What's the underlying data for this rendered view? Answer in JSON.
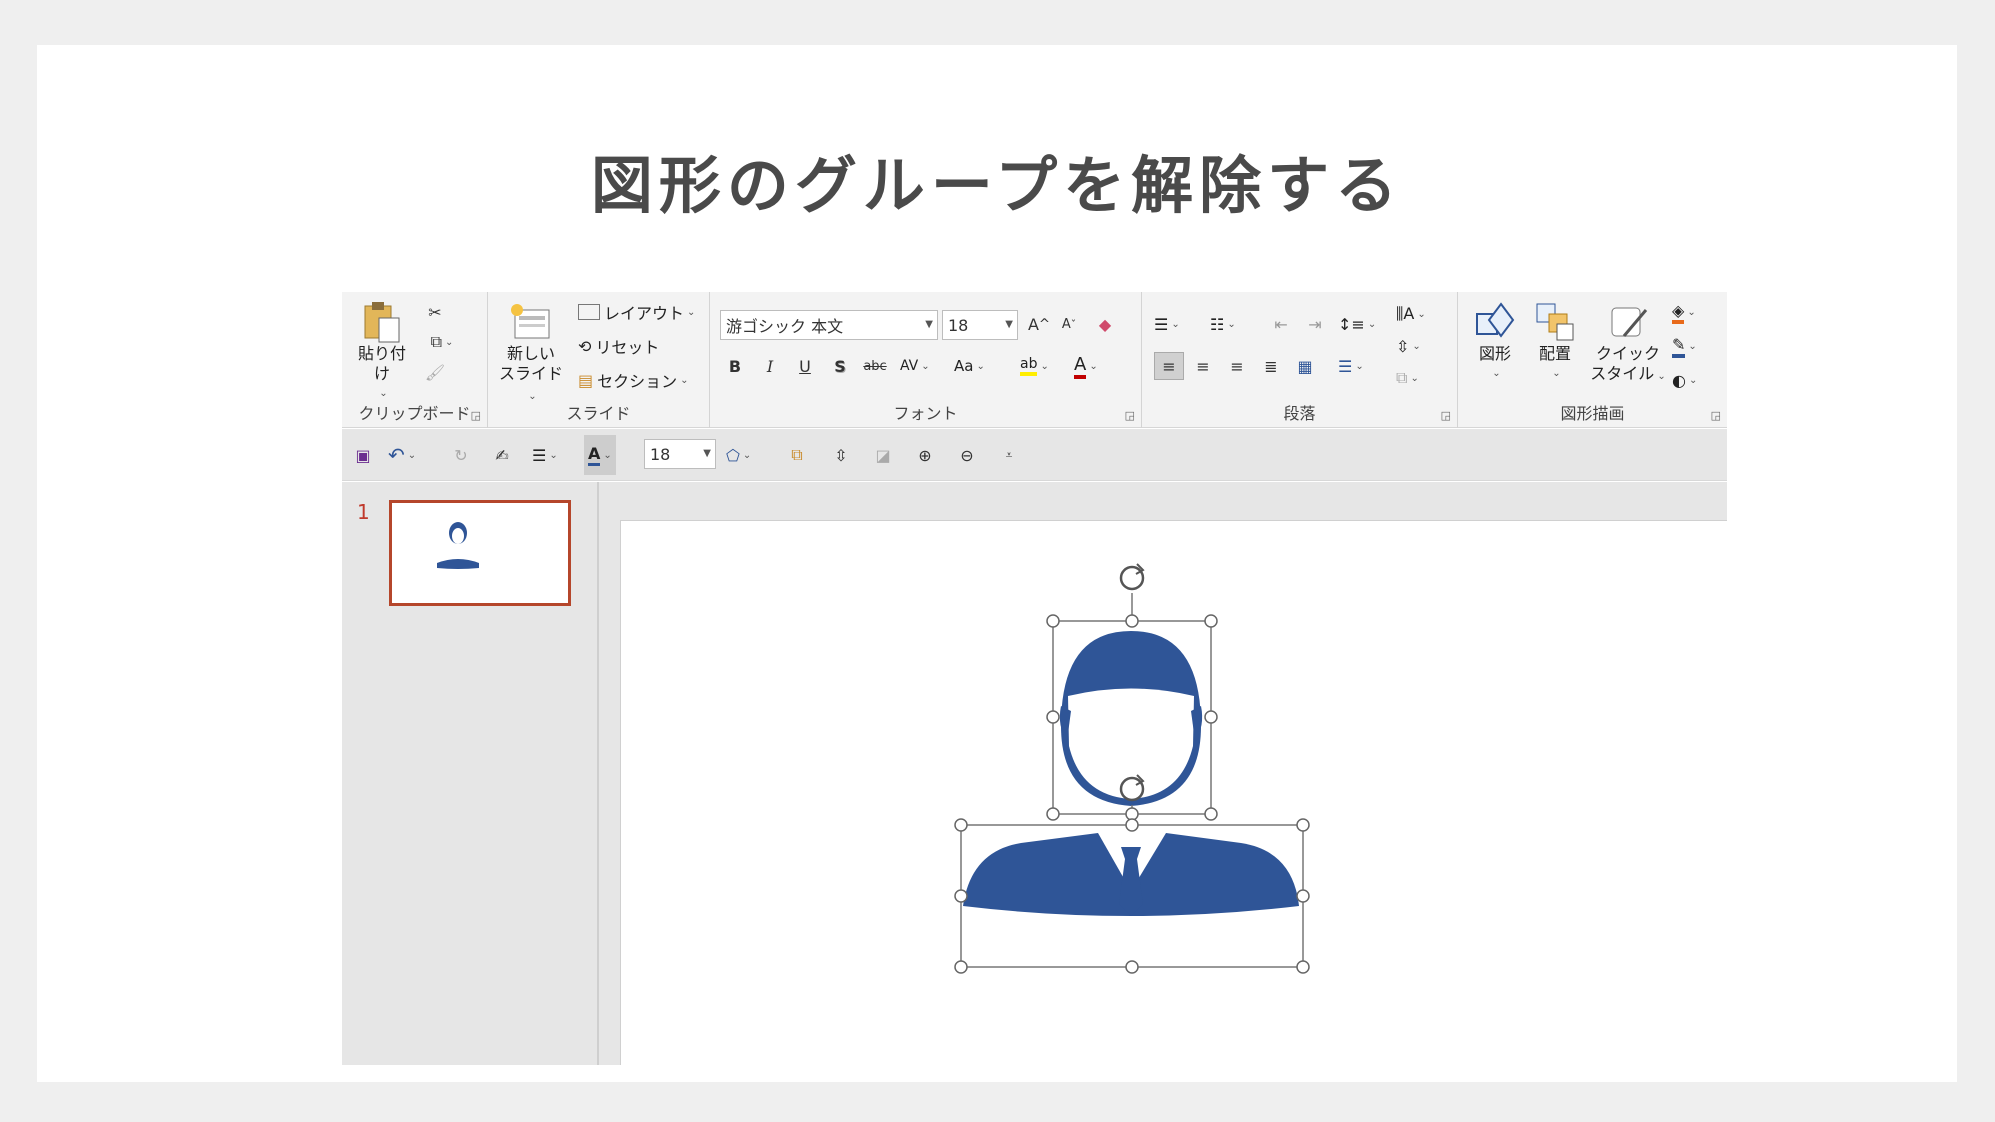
{
  "title": "図形のグループを解除する",
  "ribbon": {
    "clipboard": {
      "label": "クリップボード",
      "paste": "貼り付け"
    },
    "slides": {
      "label": "スライド",
      "new_slide_line1": "新しい",
      "new_slide_line2": "スライド",
      "layout": "レイアウト",
      "reset": "リセット",
      "section": "セクション"
    },
    "font": {
      "label": "フォント",
      "font_name": "游ゴシック 本文",
      "font_size": "18",
      "bold": "B",
      "italic": "I",
      "underline": "U",
      "shadow": "S",
      "strike": "abc",
      "spacing": "AV",
      "case": "Aa",
      "grow": "A",
      "shrink": "A",
      "color_a": "A",
      "highlight": "ab"
    },
    "paragraph": {
      "label": "段落"
    },
    "drawing": {
      "label": "図形描画",
      "shapes": "図形",
      "arrange": "配置",
      "quick_line1": "クイック",
      "quick_line2": "スタイル"
    }
  },
  "qat": {
    "font_size": "18"
  },
  "thumbnails": {
    "slide_number": "1"
  },
  "colors": {
    "accent": "#2f5597",
    "thumb_border": "#b5462b"
  },
  "icons": [
    "save-icon",
    "undo-icon",
    "redo-icon",
    "format-painter-icon",
    "bullets-icon",
    "font-color-icon",
    "shapes-icon",
    "arrange-icon",
    "zoom-in-icon",
    "zoom-out-icon",
    "rotate-handle-icon"
  ]
}
